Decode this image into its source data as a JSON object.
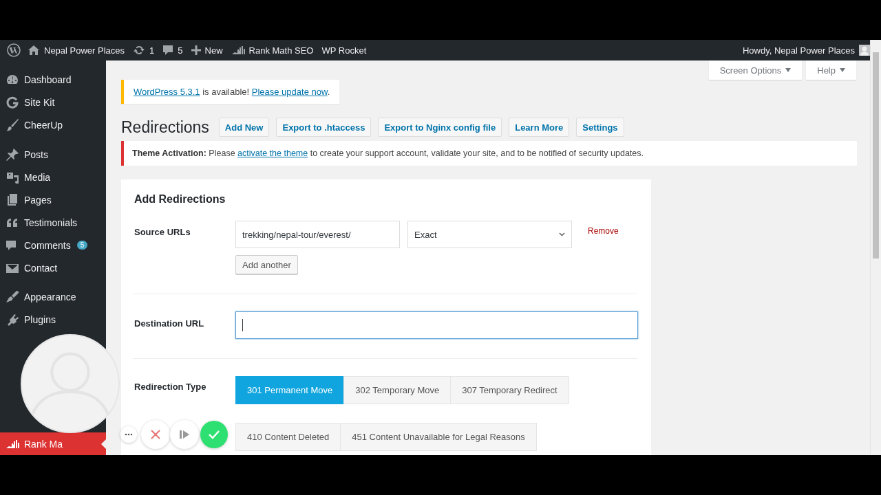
{
  "admin_bar": {
    "items": [
      {
        "kind": "home",
        "label": "Nepal Power Places"
      },
      {
        "kind": "updates",
        "label": "1"
      },
      {
        "kind": "comments",
        "label": "5"
      },
      {
        "kind": "new",
        "label": "New"
      },
      {
        "kind": "seo",
        "label": "Rank Math SEO"
      },
      {
        "kind": "text",
        "label": "WP Rocket"
      }
    ],
    "account": "Howdy, Nepal Power Places"
  },
  "sidebar": {
    "items": [
      {
        "kind": "item",
        "label": "Dashboard",
        "selected": false
      },
      {
        "kind": "item",
        "label": "Site Kit",
        "selected": false
      },
      {
        "kind": "item",
        "label": "CheerUp",
        "selected": false
      },
      {
        "kind": "separator"
      },
      {
        "kind": "item",
        "label": "Posts",
        "selected": false
      },
      {
        "kind": "item",
        "label": "Media",
        "selected": false
      },
      {
        "kind": "item",
        "label": "Pages",
        "selected": false
      },
      {
        "kind": "item",
        "label": "Testimonials",
        "selected": false
      },
      {
        "kind": "item",
        "label": "Comments",
        "badge": "5",
        "selected": false
      },
      {
        "kind": "item",
        "label": "Contact",
        "selected": false
      },
      {
        "kind": "separator"
      },
      {
        "kind": "item",
        "label": "Appearance",
        "selected": false
      },
      {
        "kind": "item",
        "label": "Plugins",
        "selected": false
      },
      {
        "kind": "hidden"
      },
      {
        "kind": "item",
        "label": "Rank Ma",
        "selected": true
      }
    ]
  },
  "screen_meta": [
    "Screen Options",
    "Help"
  ],
  "update_notice": {
    "parts": [
      {
        "text": "WordPress 5.3.1",
        "link": true
      },
      {
        "text": " is available! "
      },
      {
        "text": "Please update now",
        "link": true
      },
      {
        "text": "."
      }
    ]
  },
  "heading": "Redirections",
  "actions": [
    "Add New",
    "Export to .htaccess",
    "Export to Nginx config file",
    "Learn More",
    "Settings"
  ],
  "theme_notice": {
    "parts": [
      {
        "text": "Theme Activation:",
        "bold": true
      },
      {
        "text": " Please "
      },
      {
        "text": "activate the theme",
        "link": true
      },
      {
        "text": " to create your support account, validate your site, and to be notified of security updates."
      }
    ]
  },
  "form": {
    "title": "Add Redirections",
    "source_label": "Source URLs",
    "source_value": "trekking/nepal-tour/everest/",
    "match": "Exact",
    "remove": "Remove",
    "add_another": "Add another",
    "destination_label": "Destination URL",
    "destination_focused": true,
    "type_label": "Redirection Type",
    "types": [
      {
        "label": "301 Permanent Move",
        "selected": true
      },
      {
        "label": "302 Temporary Move",
        "selected": false
      },
      {
        "label": "307 Temporary Redirect",
        "selected": false
      }
    ],
    "codes": [
      {
        "label": "410 Content Deleted",
        "selected": false
      },
      {
        "label": "451 Content Unavailable for Legal Reasons",
        "selected": false
      }
    ]
  }
}
